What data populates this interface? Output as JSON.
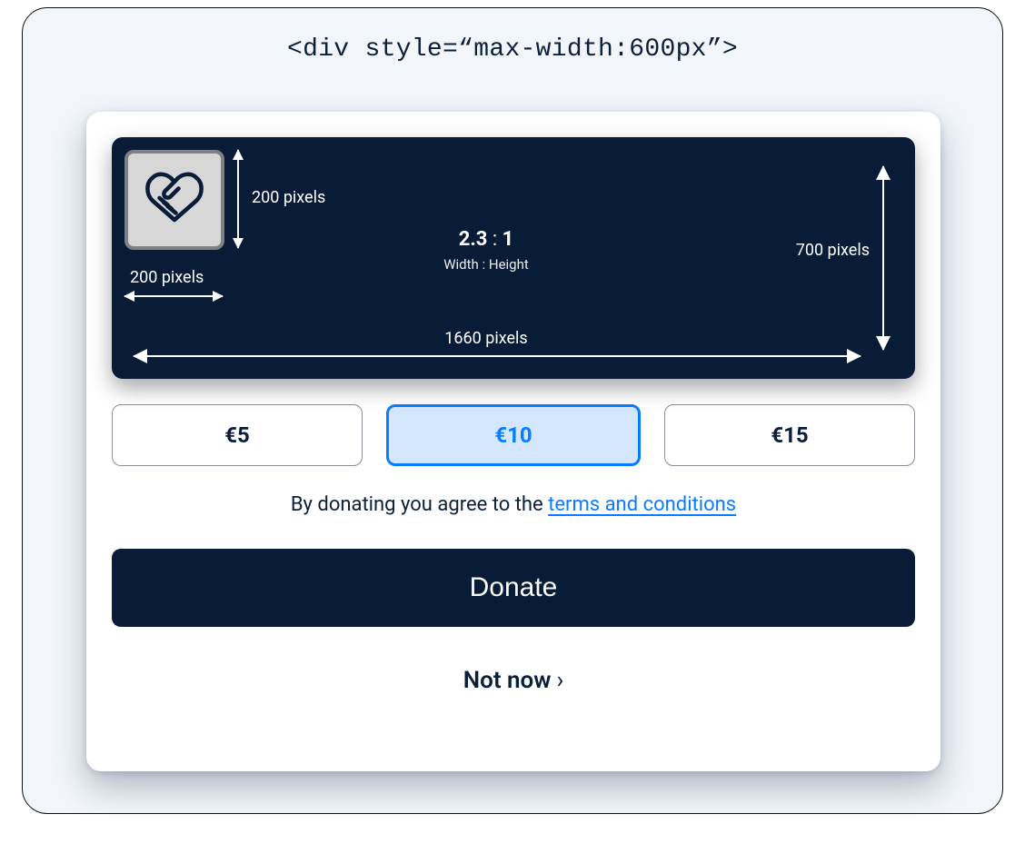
{
  "caption": "<div style=“max-width:600px”>",
  "banner": {
    "logo_size_label_v": "200 pixels",
    "logo_size_label_h": "200 pixels",
    "ratio_value": "2.3",
    "ratio_sep": " : ",
    "ratio_one": "1",
    "ratio_sub": "Width : Height",
    "width_label": "1660 pixels",
    "height_label": "700 pixels"
  },
  "amounts": {
    "opt1": "€5",
    "opt2": "€10",
    "opt3": "€15"
  },
  "terms": {
    "prefix": "By donating you agree to the ",
    "link": "terms and conditions"
  },
  "cta": {
    "donate": "Donate",
    "not_now": "Not now",
    "chevron": "›"
  }
}
